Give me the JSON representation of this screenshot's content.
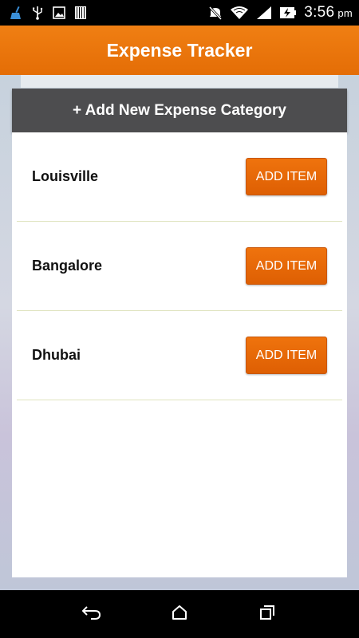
{
  "status_bar": {
    "time": "3:56",
    "ampm": "pm",
    "icons": [
      "broom-icon",
      "usb-icon",
      "image-icon",
      "barcode-icon",
      "mute-icon",
      "wifi-icon",
      "signal-icon",
      "battery-charging-icon"
    ]
  },
  "app_bar": {
    "title": "Expense Tracker"
  },
  "add_category": {
    "label": "+ Add New Expense Category"
  },
  "categories": [
    {
      "name": "Louisville",
      "button_label": "ADD ITEM"
    },
    {
      "name": "Bangalore",
      "button_label": "ADD ITEM"
    },
    {
      "name": "Dhubai",
      "button_label": "ADD ITEM"
    }
  ],
  "nav_bar": {
    "icons": [
      "back-icon",
      "home-icon",
      "recents-icon"
    ]
  },
  "colors": {
    "accent": "#e96f0a",
    "header_dark": "#4d4d4f",
    "divider": "#dfe3bf"
  }
}
